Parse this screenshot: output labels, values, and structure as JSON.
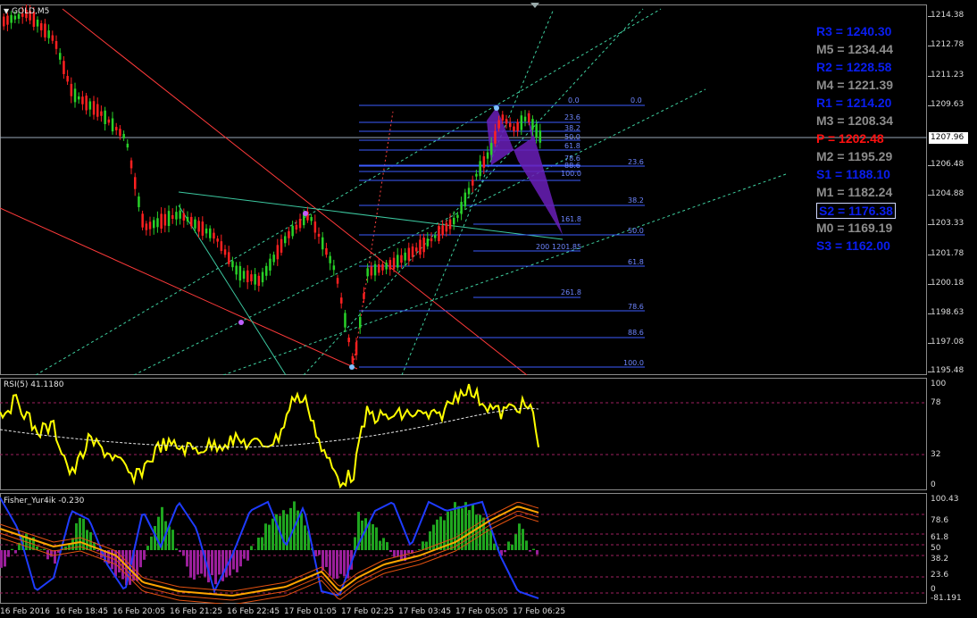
{
  "chart_title": "GOLD,M5",
  "rsi_title": "RSI(5) 41.1180",
  "fisher_title": "Fisher_Yur4ik -0.230",
  "current_price": "1207.96",
  "price_axis": [
    "1214.38",
    "1212.78",
    "1211.23",
    "1209.63",
    "1206.48",
    "1204.88",
    "1203.33",
    "1201.78",
    "1200.18",
    "1198.63",
    "1197.08",
    "1195.48"
  ],
  "rsi_axis": [
    "100",
    "78",
    "32",
    "0"
  ],
  "fisher_axis": [
    "100.43",
    "78.6",
    "61.8",
    "50",
    "38.2",
    "23.6",
    "0",
    "-81.191"
  ],
  "time_axis": [
    "16 Feb 2016",
    "16 Feb 18:45",
    "16 Feb 20:05",
    "16 Feb 21:25",
    "16 Feb 22:45",
    "17 Feb 01:05",
    "17 Feb 02:25",
    "17 Feb 03:45",
    "17 Feb 05:05",
    "17 Feb 06:25"
  ],
  "pivots": [
    {
      "label": "R3 = 1240.30",
      "color": "#0a1ef0"
    },
    {
      "label": "M5 = 1234.44",
      "color": "#8c8c8c"
    },
    {
      "label": "R2 = 1228.58",
      "color": "#0a1ef0"
    },
    {
      "label": "M4 = 1221.39",
      "color": "#8c8c8c"
    },
    {
      "label": "R1 = 1214.20",
      "color": "#0a1ef0"
    },
    {
      "label": "M3 = 1208.34",
      "color": "#8c8c8c"
    },
    {
      "label": "P  = 1202.48",
      "color": "#ff1010"
    },
    {
      "label": "M2 = 1195.29",
      "color": "#8c8c8c"
    },
    {
      "label": "S1 = 1188.10",
      "color": "#0a1ef0"
    },
    {
      "label": "M1 = 1182.24",
      "color": "#8c8c8c"
    },
    {
      "label": "S2 = 1176.38",
      "color": "#0a1ef0"
    },
    {
      "label": "M0 = 1169.19",
      "color": "#8c8c8c"
    },
    {
      "label": "S3 = 1162.00",
      "color": "#0a1ef0"
    }
  ],
  "fib_labels_a": [
    "0.0",
    "23.6",
    "38.2",
    "50.0",
    "61.8",
    "78.6",
    "88.6",
    "100.0",
    "161.8",
    "200",
    "261.8"
  ],
  "fib_labels_b": [
    "0.0",
    "23.6",
    "38.2",
    "50.0",
    "61.8",
    "78.6",
    "88.6",
    "100.0",
    "1201.85"
  ],
  "colors": {
    "bull": "#28d228",
    "bear": "#ff2020",
    "rsi": "#ffff00",
    "fib": "#3c5cff",
    "trend": "#ff3a3a",
    "channel": "#3cc8a0",
    "harmonic": "#6a1fb8"
  }
}
